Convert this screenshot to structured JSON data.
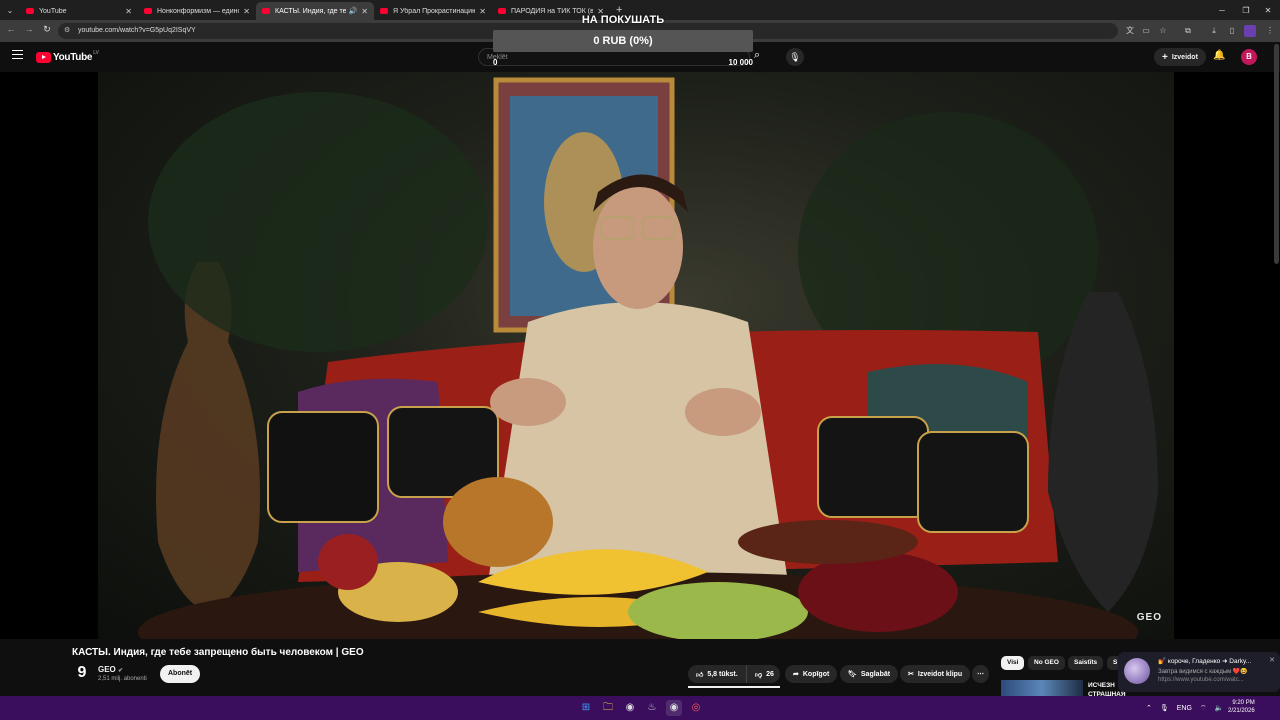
{
  "browser": {
    "tabs": [
      {
        "title": "YouTube",
        "active": false,
        "audio": false
      },
      {
        "title": "Нонконформизм — единстве",
        "active": false,
        "audio": false
      },
      {
        "title": "КАСТЫ. Индия, где тебе за",
        "active": true,
        "audio": true
      },
      {
        "title": "Я Убрал Прокрастинацию На",
        "active": false,
        "audio": false
      },
      {
        "title": "ПАРОДИЯ на ТИК ТОК (все ти",
        "active": false,
        "audio": false
      }
    ],
    "url": "youtube.com/watch?v=G5pUq2ISqVY"
  },
  "youtube": {
    "logo_text": "YouTube",
    "logo_country": "LV",
    "search_placeholder": "Meklēt",
    "create_label": "Izveidot",
    "avatar_letter": "B"
  },
  "donation": {
    "goal_label": "НА ПОКУШАТЬ",
    "progress_text": "0 RUB (0%)",
    "progress_fraction": 0,
    "min_label": "0",
    "max_label": "10 000",
    "bar_color": "#7cb342"
  },
  "video": {
    "watermark": "GEO",
    "title": "КАСТЫ. Индия, где тебе запрещено быть человеком | GEO"
  },
  "channel": {
    "logo_glyph": "9",
    "name": "GEO",
    "subscribers": "2,51 milj. abonenti",
    "subscribe_label": "Abonēt"
  },
  "actions": {
    "likes": "5,8 tūkst.",
    "dislikes": "26",
    "share": "Kopīgot",
    "save": "Saglabāt",
    "clip": "Izveidot klipu",
    "more": "⋯"
  },
  "chips": [
    {
      "label": "Visi",
      "active": true
    },
    {
      "label": "No GEO",
      "active": false
    },
    {
      "label": "Saistīts",
      "active": false
    },
    {
      "label": "S",
      "active": false
    }
  ],
  "recommended": {
    "title_line1": "ИСЧЕЗН",
    "title_line2": "СТРАШНАЯ ТАЙНА ЯПОНИИ"
  },
  "notification": {
    "line1": "💅 короче, Гладенко ➜ Darky...",
    "line2": "Завтра видимся с каждым ❤️😆",
    "line3": "https://www.youtube.com/watc..."
  },
  "taskbar": {
    "lang": "ENG",
    "time": "9:20 PM",
    "date": "2/21/2026"
  },
  "colors": {
    "yt_red": "#ff0033",
    "taskbar": "#3a0e5c",
    "avatar": "#c2185b"
  }
}
